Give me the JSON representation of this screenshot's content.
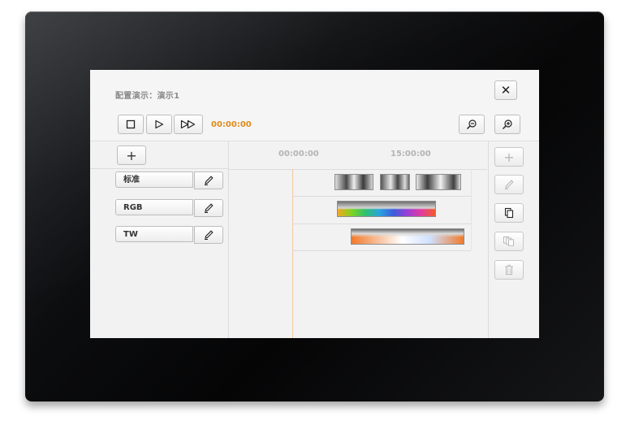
{
  "dialog": {
    "title": "配置演示：演示1",
    "close_symbol": "✕"
  },
  "transport": {
    "time": "00:00:00",
    "icons": [
      "stop-icon",
      "play-icon",
      "fast-forward-icon"
    ],
    "zoom_icons": [
      "zoom-out-icon",
      "zoom-in-icon"
    ]
  },
  "channels": {
    "add_symbol": "+",
    "items": [
      {
        "label": "标准"
      },
      {
        "label": "RGB"
      },
      {
        "label": "TW"
      }
    ]
  },
  "timeline": {
    "ticks": [
      "00:00:00",
      "15:00:00"
    ]
  },
  "sidebar_actions": {
    "icons": [
      "add-icon",
      "edit-icon",
      "copy-icon",
      "copy-multiple-icon",
      "trash-icon"
    ],
    "add_symbol": "+"
  },
  "colors": {
    "accent": "#e08a1a",
    "device_frame": "#0c0d0f",
    "screen_bg": "#f1f1f1"
  }
}
